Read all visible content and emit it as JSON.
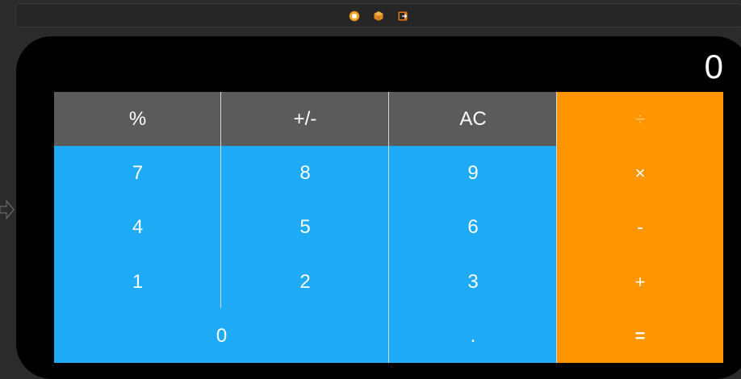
{
  "colors": {
    "background": "#2b2b2b",
    "device": "#000000",
    "function_key": "#5b5b5b",
    "number_key": "#1eaaf5",
    "operator_key": "#ff9500",
    "key_text": "#ffffff"
  },
  "scene_bar": {
    "icons": [
      "view-controller-icon",
      "first-responder-icon",
      "exit-icon"
    ]
  },
  "display": {
    "value": "0"
  },
  "keys": {
    "percent": "%",
    "sign": "+/-",
    "clear": "AC",
    "divide": "÷",
    "seven": "7",
    "eight": "8",
    "nine": "9",
    "multiply": "×",
    "four": "4",
    "five": "5",
    "six": "6",
    "subtract": "-",
    "one": "1",
    "two": "2",
    "three": "3",
    "add": "+",
    "zero": "0",
    "decimal": ".",
    "equals": "="
  }
}
